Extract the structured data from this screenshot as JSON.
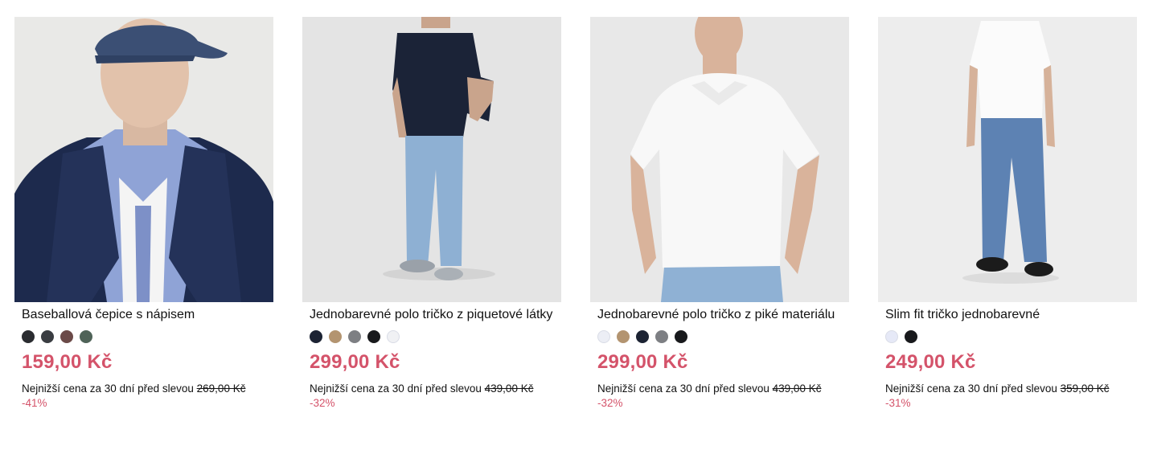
{
  "products": [
    {
      "title": "Baseballová čepice s nápisem",
      "swatches": [
        "#2a2c30",
        "#3a3d42",
        "#6b4a48",
        "#4f6358"
      ],
      "price": "159,00 Kč",
      "lowest_label": "Nejnižší cena za 30 dní před slevou",
      "lowest_price": "269,00 Kč",
      "discount": "-41%"
    },
    {
      "title": "Jednobarevné polo tričko z piquetové látky",
      "swatches": [
        "#1c2333",
        "#b39470",
        "#7d7f83",
        "#18191c",
        "#f0f1f4"
      ],
      "price": "299,00 Kč",
      "lowest_label": "Nejnižší cena za 30 dní před slevou",
      "lowest_price": "439,00 Kč",
      "discount": "-32%"
    },
    {
      "title": "Jednobarevné polo tričko z piké materiálu",
      "swatches": [
        "#eceef5",
        "#b39470",
        "#1c2333",
        "#7d7f83",
        "#18191c"
      ],
      "price": "299,00 Kč",
      "lowest_label": "Nejnižší cena za 30 dní před slevou",
      "lowest_price": "439,00 Kč",
      "discount": "-32%"
    },
    {
      "title": "Slim fit tričko jednobarevné",
      "swatches": [
        "#e6e9f7",
        "#18191c"
      ],
      "price": "249,00 Kč",
      "lowest_label": "Nejnižší cena za 30 dní před slevou",
      "lowest_price": "359,00 Kč",
      "discount": "-31%"
    }
  ],
  "colors": {
    "price": "#d4536a",
    "image_bg": "#ebebeb"
  }
}
